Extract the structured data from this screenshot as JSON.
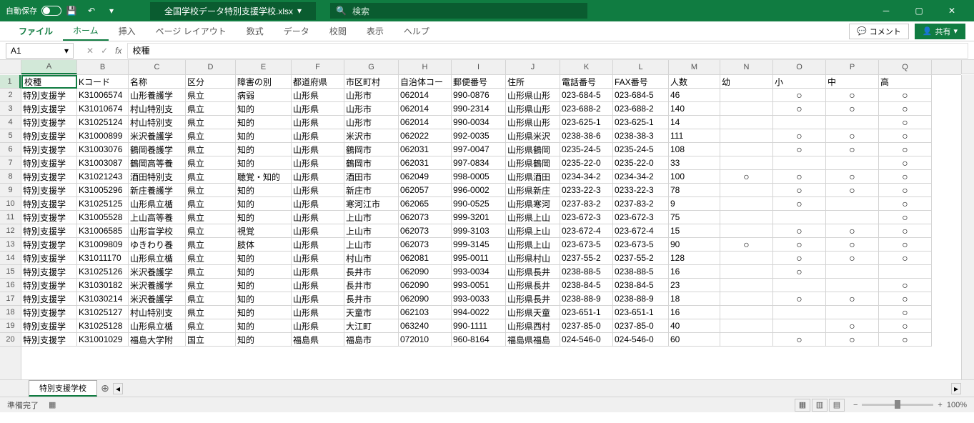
{
  "titlebar": {
    "autosave": "自動保存",
    "filename": "全国学校データ特別支援学校.xlsx",
    "search_placeholder": "検索"
  },
  "ribbon": {
    "tabs": [
      "ファイル",
      "ホーム",
      "挿入",
      "ページ レイアウト",
      "数式",
      "データ",
      "校閲",
      "表示",
      "ヘルプ"
    ],
    "comment": "コメント",
    "share": "共有"
  },
  "fx": {
    "name": "A1",
    "formula": "校種"
  },
  "columns": [
    "A",
    "B",
    "C",
    "D",
    "E",
    "F",
    "G",
    "H",
    "I",
    "J",
    "K",
    "L",
    "M",
    "N",
    "O",
    "P",
    "Q"
  ],
  "header_row": [
    "校種",
    "Kコード",
    "名称",
    "区分",
    "障害の別",
    "都道府県",
    "市区町村",
    "自治体コー",
    "郵便番号",
    "住所",
    "電話番号",
    "FAX番号",
    "人数",
    "幼",
    "小",
    "中",
    "高"
  ],
  "rows": [
    [
      "特別支援学",
      "K31006574",
      "山形養護学",
      "県立",
      "病弱",
      "山形県",
      "山形市",
      "062014",
      "990-0876",
      "山形県山形",
      "023-684-5",
      "023-684-5",
      "46",
      "",
      "○",
      "○",
      "○"
    ],
    [
      "特別支援学",
      "K31010674",
      "村山特別支",
      "県立",
      "知的",
      "山形県",
      "山形市",
      "062014",
      "990-2314",
      "山形県山形",
      "023-688-2",
      "023-688-2",
      "140",
      "",
      "○",
      "○",
      "○"
    ],
    [
      "特別支援学",
      "K31025124",
      "村山特別支",
      "県立",
      "知的",
      "山形県",
      "山形市",
      "062014",
      "990-0034",
      "山形県山形",
      "023-625-1",
      "023-625-1",
      "14",
      "",
      "",
      "",
      "○"
    ],
    [
      "特別支援学",
      "K31000899",
      "米沢養護学",
      "県立",
      "知的",
      "山形県",
      "米沢市",
      "062022",
      "992-0035",
      "山形県米沢",
      "0238-38-6",
      "0238-38-3",
      "111",
      "",
      "○",
      "○",
      "○"
    ],
    [
      "特別支援学",
      "K31003076",
      "鶴岡養護学",
      "県立",
      "知的",
      "山形県",
      "鶴岡市",
      "062031",
      "997-0047",
      "山形県鶴岡",
      "0235-24-5",
      "0235-24-5",
      "108",
      "",
      "○",
      "○",
      "○"
    ],
    [
      "特別支援学",
      "K31003087",
      "鶴岡高等養",
      "県立",
      "知的",
      "山形県",
      "鶴岡市",
      "062031",
      "997-0834",
      "山形県鶴岡",
      "0235-22-0",
      "0235-22-0",
      "33",
      "",
      "",
      "",
      "○"
    ],
    [
      "特別支援学",
      "K31021243",
      "酒田特別支",
      "県立",
      "聴覚・知的",
      "山形県",
      "酒田市",
      "062049",
      "998-0005",
      "山形県酒田",
      "0234-34-2",
      "0234-34-2",
      "100",
      "○",
      "○",
      "○",
      "○"
    ],
    [
      "特別支援学",
      "K31005296",
      "新庄養護学",
      "県立",
      "知的",
      "山形県",
      "新庄市",
      "062057",
      "996-0002",
      "山形県新庄",
      "0233-22-3",
      "0233-22-3",
      "78",
      "",
      "○",
      "○",
      "○"
    ],
    [
      "特別支援学",
      "K31025125",
      "山形県立楯",
      "県立",
      "知的",
      "山形県",
      "寒河江市",
      "062065",
      "990-0525",
      "山形県寒河",
      "0237-83-2",
      "0237-83-2",
      "9",
      "",
      "○",
      "",
      "○"
    ],
    [
      "特別支援学",
      "K31005528",
      "上山高等養",
      "県立",
      "知的",
      "山形県",
      "上山市",
      "062073",
      "999-3201",
      "山形県上山",
      "023-672-3",
      "023-672-3",
      "75",
      "",
      "",
      "",
      "○"
    ],
    [
      "特別支援学",
      "K31006585",
      "山形盲学校",
      "県立",
      "視覚",
      "山形県",
      "上山市",
      "062073",
      "999-3103",
      "山形県上山",
      "023-672-4",
      "023-672-4",
      "15",
      "",
      "○",
      "○",
      "○"
    ],
    [
      "特別支援学",
      "K31009809",
      "ゆきわり養",
      "県立",
      "肢体",
      "山形県",
      "上山市",
      "062073",
      "999-3145",
      "山形県上山",
      "023-673-5",
      "023-673-5",
      "90",
      "○",
      "○",
      "○",
      "○"
    ],
    [
      "特別支援学",
      "K31011170",
      "山形県立楯",
      "県立",
      "知的",
      "山形県",
      "村山市",
      "062081",
      "995-0011",
      "山形県村山",
      "0237-55-2",
      "0237-55-2",
      "128",
      "",
      "○",
      "○",
      "○"
    ],
    [
      "特別支援学",
      "K31025126",
      "米沢養護学",
      "県立",
      "知的",
      "山形県",
      "長井市",
      "062090",
      "993-0034",
      "山形県長井",
      "0238-88-5",
      "0238-88-5",
      "16",
      "",
      "○",
      "",
      ""
    ],
    [
      "特別支援学",
      "K31030182",
      "米沢養護学",
      "県立",
      "知的",
      "山形県",
      "長井市",
      "062090",
      "993-0051",
      "山形県長井",
      "0238-84-5",
      "0238-84-5",
      "23",
      "",
      "",
      "",
      "○"
    ],
    [
      "特別支援学",
      "K31030214",
      "米沢養護学",
      "県立",
      "知的",
      "山形県",
      "長井市",
      "062090",
      "993-0033",
      "山形県長井",
      "0238-88-9",
      "0238-88-9",
      "18",
      "",
      "○",
      "○",
      "○"
    ],
    [
      "特別支援学",
      "K31025127",
      "村山特別支",
      "県立",
      "知的",
      "山形県",
      "天童市",
      "062103",
      "994-0022",
      "山形県天童",
      "023-651-1",
      "023-651-1",
      "16",
      "",
      "",
      "",
      "○"
    ],
    [
      "特別支援学",
      "K31025128",
      "山形県立楯",
      "県立",
      "知的",
      "山形県",
      "大江町",
      "063240",
      "990-1111",
      "山形県西村",
      "0237-85-0",
      "0237-85-0",
      "40",
      "",
      "",
      "○",
      "○"
    ],
    [
      "特別支援学",
      "K31001029",
      "福島大学附",
      "国立",
      "知的",
      "福島県",
      "福島市",
      "072010",
      "960-8164",
      "福島県福島",
      "024-546-0",
      "024-546-0",
      "60",
      "",
      "○",
      "○",
      "○"
    ]
  ],
  "sheet": {
    "name": "特別支援学校"
  },
  "status": {
    "ready": "準備完了",
    "zoom": "100%"
  }
}
